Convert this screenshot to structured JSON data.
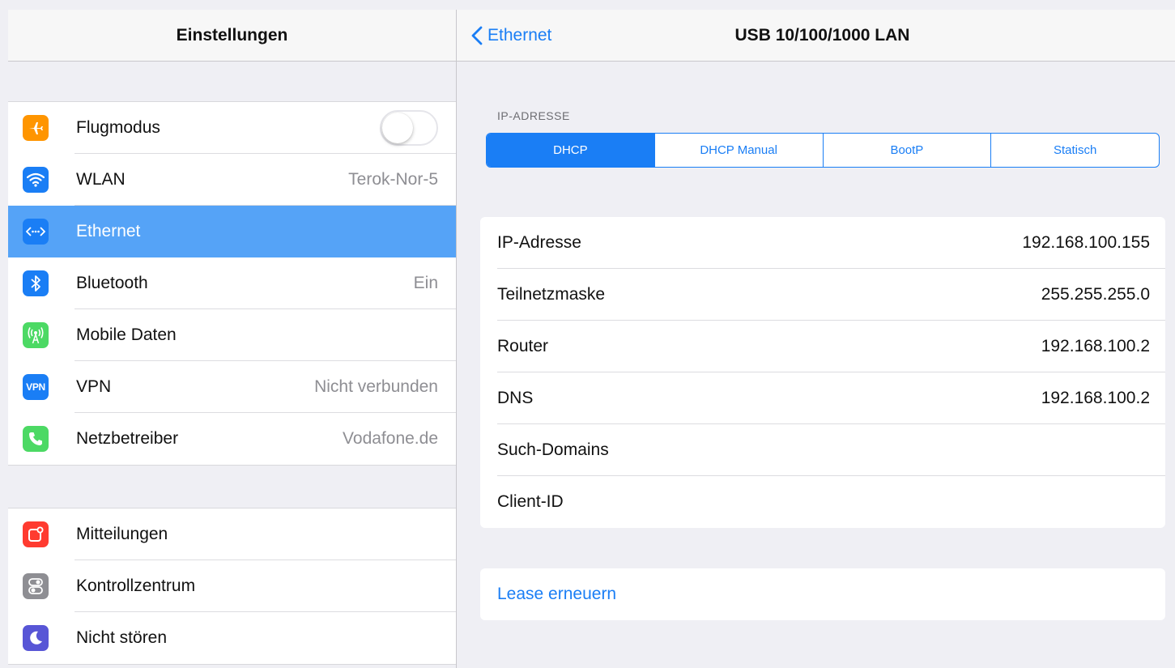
{
  "sidebar": {
    "title": "Einstellungen",
    "groups": [
      {
        "items": [
          {
            "label": "Flugmodus",
            "value": "",
            "toggle": "off",
            "icon": "airplane-icon",
            "color": "#ff9500"
          },
          {
            "label": "WLAN",
            "value": "Terok-Nor-5",
            "icon": "wifi-icon",
            "color": "#1a7ef5"
          },
          {
            "label": "Ethernet",
            "value": "",
            "icon": "ethernet-icon",
            "color": "#1a7ef5",
            "selected": true
          },
          {
            "label": "Bluetooth",
            "value": "Ein",
            "icon": "bluetooth-icon",
            "color": "#1a7ef5"
          },
          {
            "label": "Mobile Daten",
            "value": "",
            "icon": "cellular-icon",
            "color": "#4cd964"
          },
          {
            "label": "VPN",
            "value": "Nicht verbunden",
            "icon": "vpn-icon",
            "color": "#1a7ef5",
            "icon_text": "VPN"
          },
          {
            "label": "Netzbetreiber",
            "value": "Vodafone.de",
            "icon": "phone-icon",
            "color": "#4cd964"
          }
        ]
      },
      {
        "items": [
          {
            "label": "Mitteilungen",
            "value": "",
            "icon": "notifications-icon",
            "color": "#ff3b30"
          },
          {
            "label": "Kontrollzentrum",
            "value": "",
            "icon": "control-center-icon",
            "color": "#8e8e93"
          },
          {
            "label": "Nicht stören",
            "value": "",
            "icon": "moon-icon",
            "color": "#5856d6"
          }
        ]
      }
    ]
  },
  "detail": {
    "back_label": "Ethernet",
    "title": "USB 10/100/1000 LAN",
    "section_label": "IP-ADRESSE",
    "segments": [
      "DHCP",
      "DHCP Manual",
      "BootP",
      "Statisch"
    ],
    "active_segment": "DHCP",
    "info_rows": [
      {
        "label": "IP-Adresse",
        "value": "192.168.100.155"
      },
      {
        "label": "Teilnetzmaske",
        "value": "255.255.255.0"
      },
      {
        "label": "Router",
        "value": "192.168.100.2"
      },
      {
        "label": "DNS",
        "value": "192.168.100.2"
      },
      {
        "label": "Such-Domains",
        "value": ""
      },
      {
        "label": "Client-ID",
        "value": ""
      }
    ],
    "lease_label": "Lease erneuern"
  },
  "colors": {
    "accent": "#1a7ef5",
    "selected_row": "#55a3f7",
    "background": "#efeff4"
  }
}
